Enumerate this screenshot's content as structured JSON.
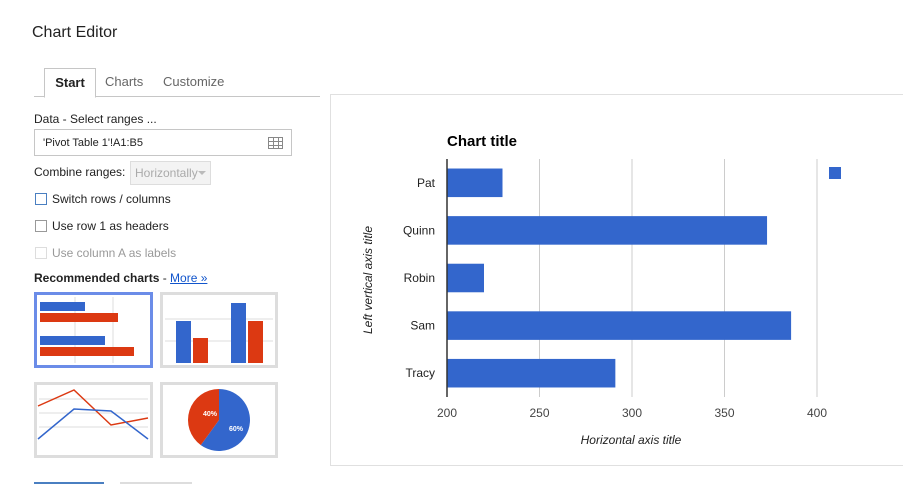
{
  "window": {
    "title": "Chart Editor"
  },
  "tabs": [
    {
      "label": "Start",
      "active": true
    },
    {
      "label": "Charts",
      "active": false
    },
    {
      "label": "Customize",
      "active": false
    }
  ],
  "data_section": {
    "label": "Data - Select ranges ...",
    "range_value": "'Pivot Table 1'!A1:B5",
    "combine_label": "Combine ranges:",
    "combine_value": "Horizontally"
  },
  "options": {
    "switch_rows": "Switch rows / columns",
    "use_row1": "Use row 1 as headers",
    "use_colA": "Use column A as labels"
  },
  "recommended": {
    "label": "Recommended charts",
    "dash": " - ",
    "more_link": "More »",
    "pie_labels": [
      "40%",
      "60%"
    ]
  },
  "colors": {
    "blue": "#3366cc",
    "red": "#dc3912",
    "accent": "#6b8ce8"
  },
  "chart_data": {
    "type": "bar",
    "orientation": "horizontal",
    "title": "Chart title",
    "xlabel": "Horizontal axis title",
    "ylabel": "Left vertical axis title",
    "categories": [
      "Pat",
      "Quinn",
      "Robin",
      "Sam",
      "Tracy"
    ],
    "values": [
      230,
      373,
      220,
      386,
      291
    ],
    "xlim": [
      200,
      400
    ],
    "xticks": [
      "200",
      "250",
      "300",
      "350",
      "400"
    ],
    "grid": true,
    "legend_position": "top-right",
    "color": "#3366cc"
  }
}
